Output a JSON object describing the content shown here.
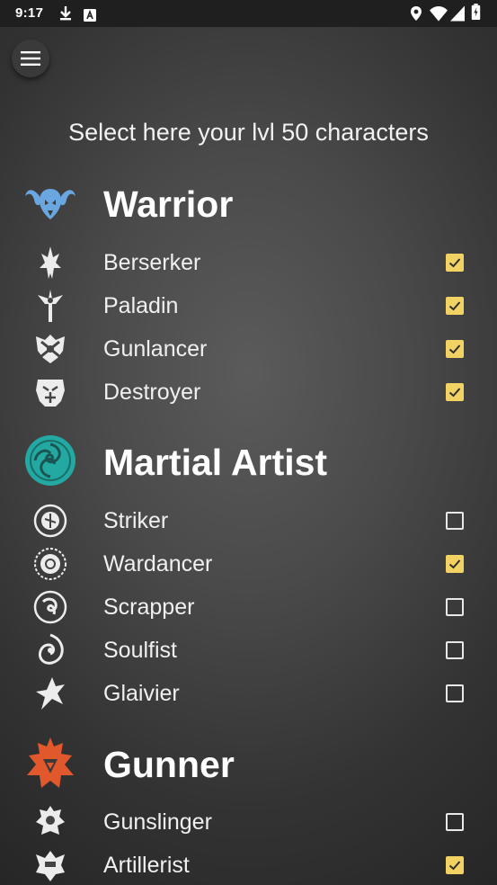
{
  "status_bar": {
    "time": "9:17",
    "left_icons": [
      "download-icon",
      "text-a-icon"
    ],
    "right_icons": [
      "location-icon",
      "wifi-icon",
      "signal-icon",
      "battery-icon"
    ]
  },
  "menu": {
    "icon": "hamburger-menu-icon"
  },
  "heading": "Select here your lvl 50 characters",
  "colors": {
    "checkbox_checked": "#f2d263",
    "warrior_icon": "#6aa7e0",
    "martial_artist_icon": "#23a9a2",
    "gunner_icon": "#e0582c"
  },
  "sections": [
    {
      "title": "Warrior",
      "icon": "warrior-class-icon",
      "classes": [
        {
          "name": "Berserker",
          "checked": true
        },
        {
          "name": "Paladin",
          "checked": true
        },
        {
          "name": "Gunlancer",
          "checked": true
        },
        {
          "name": "Destroyer",
          "checked": true
        }
      ]
    },
    {
      "title": "Martial Artist",
      "icon": "martial-artist-class-icon",
      "classes": [
        {
          "name": "Striker",
          "checked": false
        },
        {
          "name": "Wardancer",
          "checked": true
        },
        {
          "name": "Scrapper",
          "checked": false
        },
        {
          "name": "Soulfist",
          "checked": false
        },
        {
          "name": "Glaivier",
          "checked": false
        }
      ]
    },
    {
      "title": "Gunner",
      "icon": "gunner-class-icon",
      "classes": [
        {
          "name": "Gunslinger",
          "checked": false
        },
        {
          "name": "Artillerist",
          "checked": true
        }
      ]
    }
  ]
}
